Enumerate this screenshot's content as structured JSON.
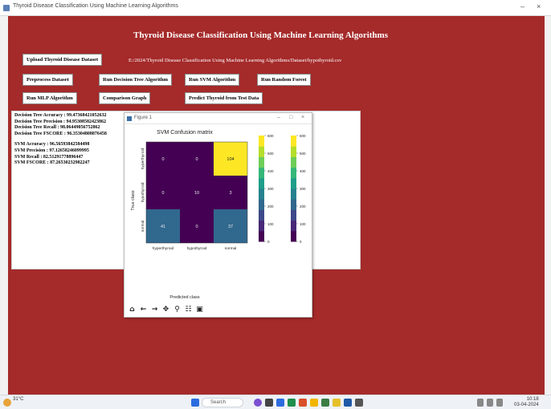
{
  "window": {
    "title": "Thyroid Disease Classification Using Machine Learning Algorithms",
    "controls": [
      "–",
      "×"
    ]
  },
  "app": {
    "title": "Thyroid Disease Classification Using Machine Learning Algorithms",
    "dataset_path": "E:/2024/Thyroid Disease Classification Using Machine Learning Algorithms/Dataset/hypothyroid.csv",
    "buttons": {
      "upload": "Upload Thyroid Disease Dataset",
      "preprocess": "Preprocess Dataset",
      "decision_tree": "Run Decision Tree Algorithm",
      "svm": "Run SVM Algorithm",
      "random_forest": "Run Random Forest",
      "mlp": "Run MLP Algorithm",
      "comparison": "Comparison Graph",
      "predict": "Predict Thyroid from Test Data"
    },
    "output_lines": [
      "Decision Tree Accuracy  : 99.47368421052632",
      "Decision Tree Precision : 94.95308582423862",
      "Decision Tree Recall    : 98.06449056752862",
      "Decision Tree FSCORE    : 96.35304808876458",
      "",
      "SVM Accuracy  : 96.56593842584498",
      "SVM Precision : 97.12658246099995",
      "SVM Recall    : 82.51291778896447",
      "SVM FSCORE    : 87.26530232982247"
    ]
  },
  "figure": {
    "window_title": "Figure 1",
    "controls": [
      "–",
      "□",
      "×"
    ],
    "toolbar": [
      "⌂",
      "←",
      "→",
      "✥",
      "⚲",
      "☷",
      "▣"
    ]
  },
  "chart_data": {
    "type": "heatmap",
    "title": "SVM Confusion matrix",
    "xlabel": "Predicted class",
    "ylabel": "True class",
    "categories": [
      "hyperthyroid",
      "hypothyroid",
      "normal"
    ],
    "values": [
      [
        0,
        0,
        104
      ],
      [
        0,
        10,
        3
      ],
      [
        41,
        0,
        37
      ]
    ],
    "colormap": "viridis",
    "colorbars": [
      {
        "ticks": [
          0,
          100,
          200,
          300,
          400,
          500,
          600
        ]
      },
      {
        "ticks": [
          0,
          100,
          200,
          300,
          400,
          500,
          600
        ]
      }
    ]
  },
  "taskbar": {
    "weather": "31°C",
    "search_placeholder": "Search",
    "clock_time": "10:18",
    "clock_date": "03-04-2024"
  },
  "colors": {
    "app_bg": "#a52a2a",
    "cm_low": "#440154",
    "cm_high": "#fde725"
  }
}
